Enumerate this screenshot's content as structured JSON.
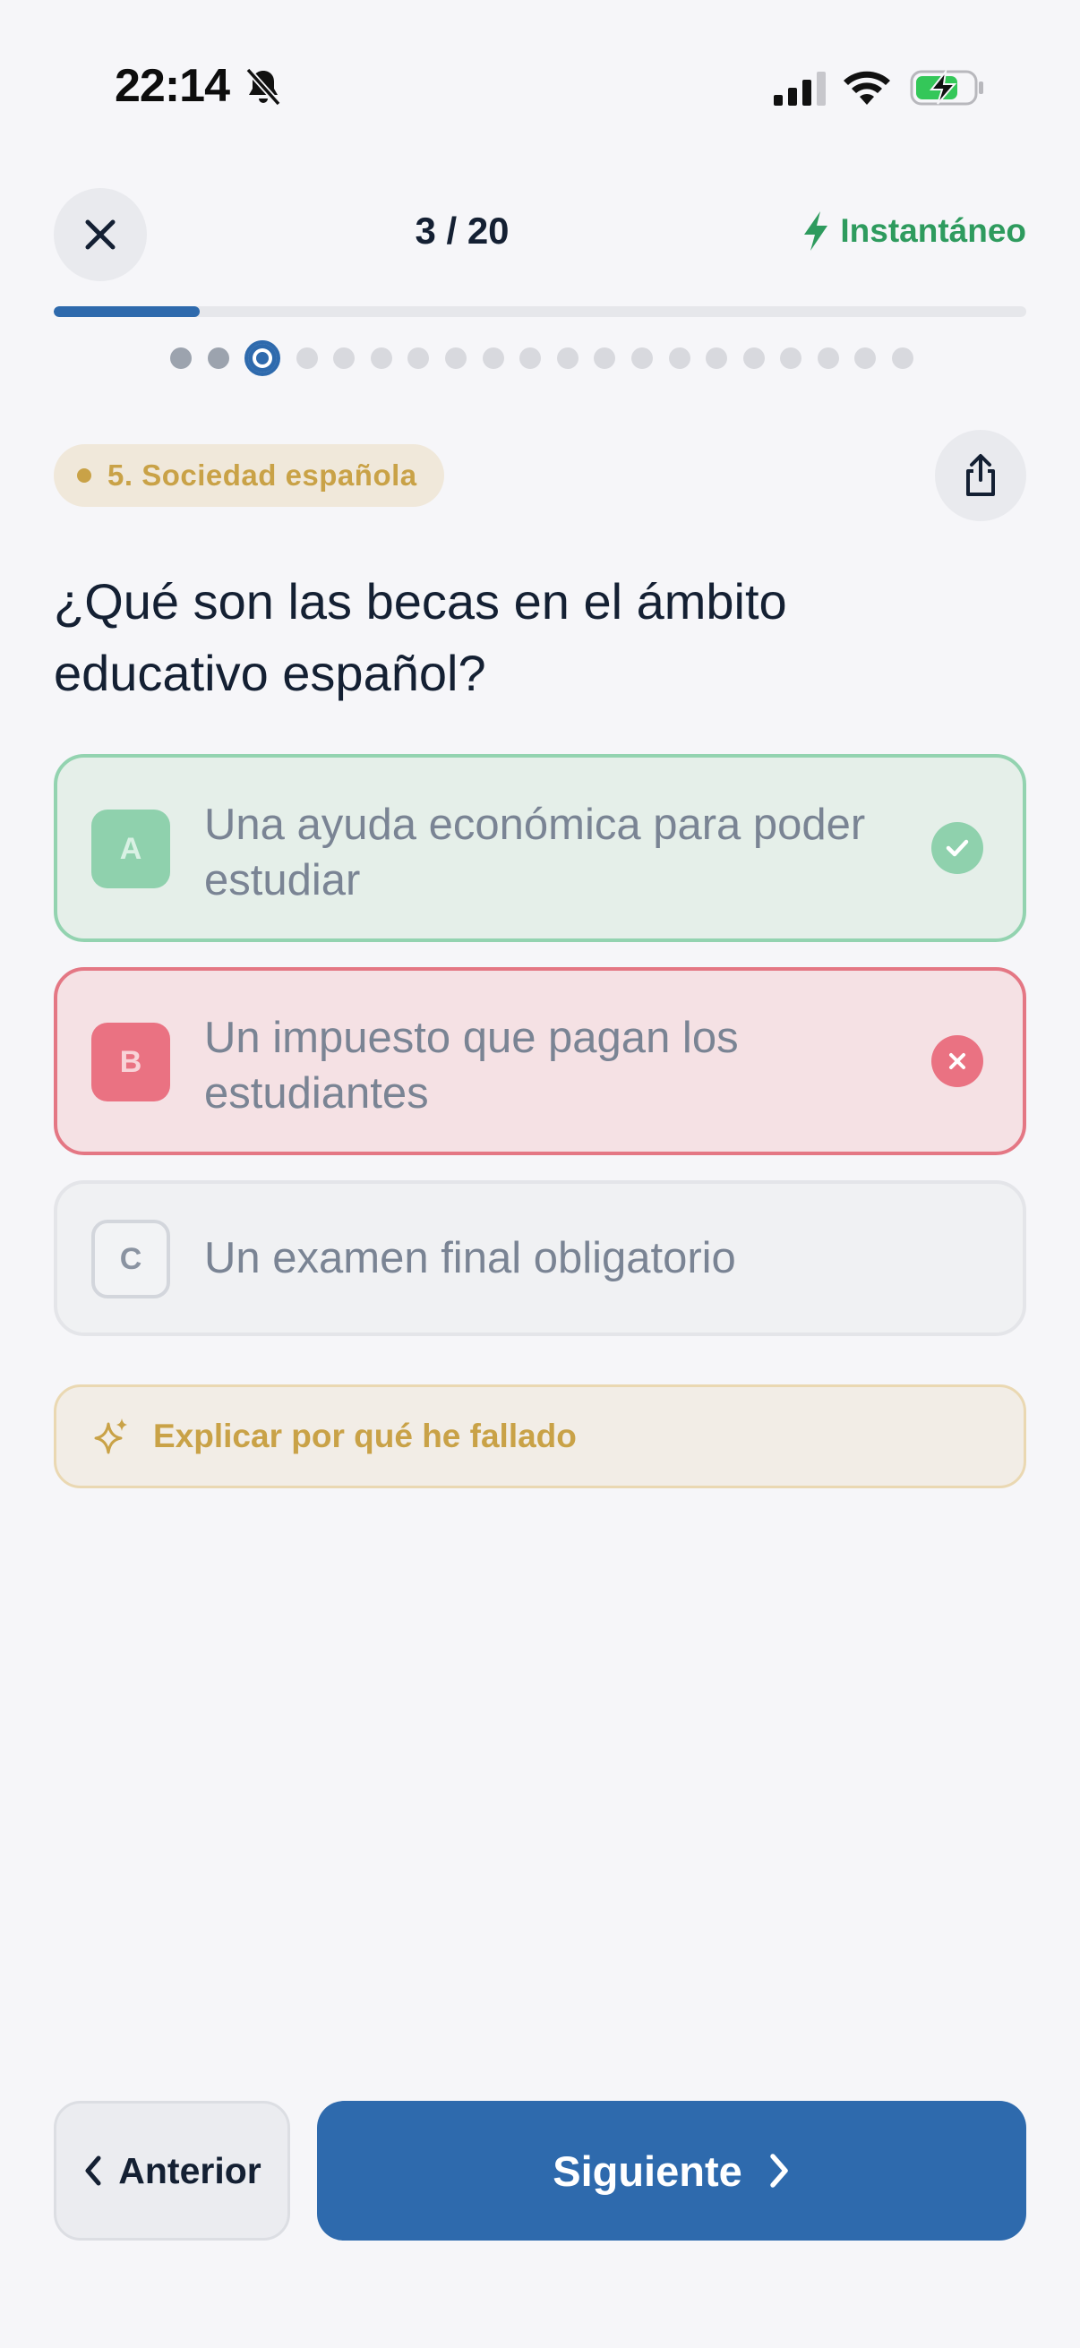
{
  "status_bar": {
    "time": "22:14",
    "icons": [
      "bell-slash-icon",
      "cellular-signal-icon",
      "wifi-icon",
      "battery-charging-icon"
    ]
  },
  "header": {
    "progress_text": "3 / 20",
    "current_question": 3,
    "total_questions": 20,
    "progress_fraction": 0.15,
    "mode_label": "Instantáneo",
    "mode_color": "#2e9b5e"
  },
  "question_dots": {
    "count": 20,
    "current_index": 2,
    "answered": [
      0,
      1
    ]
  },
  "category": {
    "label": "5. Sociedad española",
    "color": "#c9a247"
  },
  "question": {
    "text": "¿Qué son las becas en el ámbito educativo español?"
  },
  "options": [
    {
      "letter": "A",
      "text": "Una ayuda económica para poder estudiar",
      "state": "correct"
    },
    {
      "letter": "B",
      "text": "Un impuesto que pagan los estudiantes",
      "state": "wrong"
    },
    {
      "letter": "C",
      "text": "Un examen final obligatorio",
      "state": "neutral"
    }
  ],
  "explain": {
    "label": "Explicar por qué he fallado"
  },
  "navigation": {
    "prev_label": "Anterior",
    "next_label": "Siguiente",
    "primary_color": "#2e6aad"
  }
}
